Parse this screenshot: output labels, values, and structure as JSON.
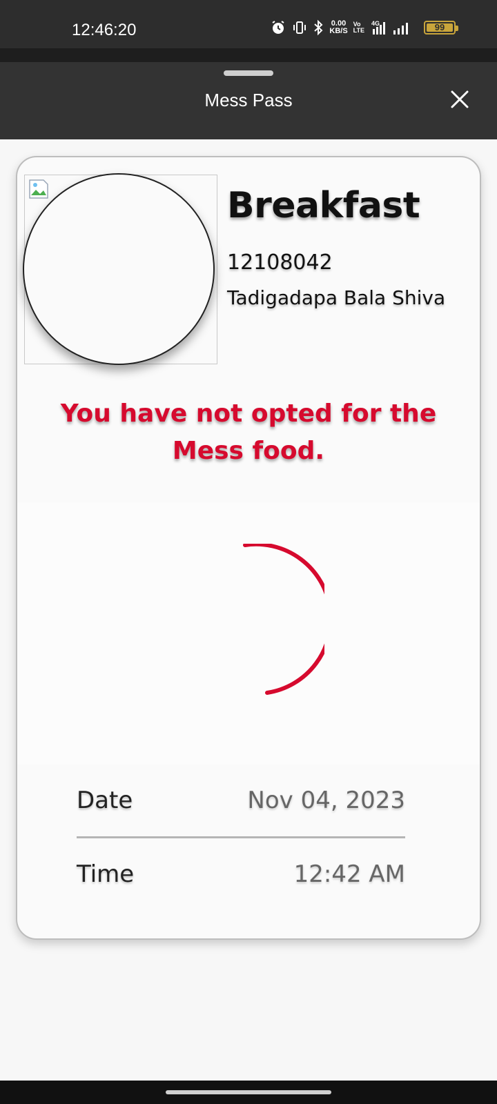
{
  "status_bar": {
    "time": "12:46:20",
    "net_speed_value": "0.00",
    "net_speed_unit": "KB/S",
    "volte_top": "Vo",
    "volte_bottom": "LTE",
    "network_type": "4G",
    "battery_level": "99"
  },
  "sheet": {
    "title": "Mess Pass"
  },
  "pass": {
    "meal": "Breakfast",
    "registration_number": "12108042",
    "student_name": "Tadigadapa Bala Shiva",
    "alert_message": "You have not opted for the Mess food.",
    "date_label": "Date",
    "date_value": "Nov 04, 2023",
    "time_label": "Time",
    "time_value": "12:42 AM"
  },
  "colors": {
    "alert": "#d60a2e",
    "header_bg": "#333333",
    "spinner": "#d60a2e"
  },
  "icons": [
    "alarm-icon",
    "vibrate-icon",
    "bluetooth-icon",
    "signal-icon",
    "battery-icon",
    "close-icon",
    "broken-image-icon",
    "loading-spinner-icon"
  ]
}
